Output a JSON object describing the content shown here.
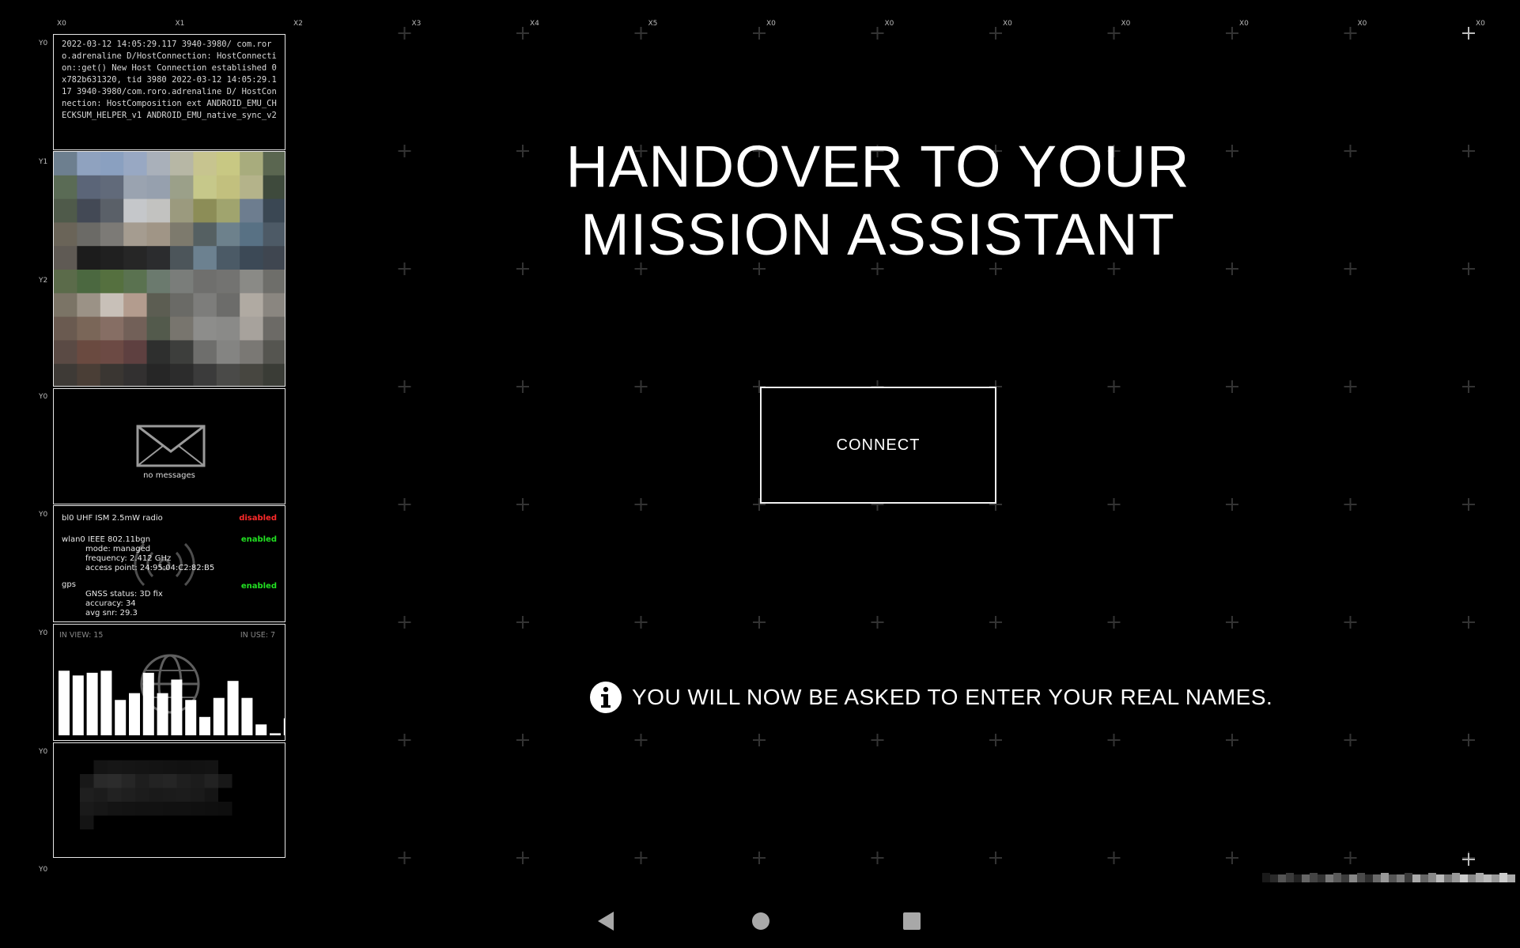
{
  "axis_labels": {
    "top": [
      "X0",
      "X1",
      "X2",
      "X3",
      "X4",
      "X5",
      "X0",
      "X0",
      "X0",
      "X0",
      "X0",
      "X0",
      "X0"
    ],
    "left": [
      "Y0",
      "Y1",
      "Y2",
      "Y0",
      "Y0",
      "Y0",
      "Y0",
      "Y0"
    ]
  },
  "log": {
    "text": "2022-03-12 14:05:29.117 3940-3980/ com.roro.adrenaline D/HostConnection: HostConnection::get() New Host Connection established 0x782b631320, tid 3980 2022-03-12 14:05:29.117 3940-3980/com.roro.adrenaline D/ HostConnection: HostComposition ext ANDROID_EMU_CHECKSUM_HELPER_v1 ANDROID_EMU_native_sync_v2"
  },
  "messages": {
    "empty_label": "no messages",
    "icon": "envelope-icon"
  },
  "status": {
    "radio": {
      "label": "bl0 UHF ISM 2.5mW radio",
      "state": "disabled"
    },
    "wlan": {
      "label": "wlan0 IEEE 802.11bgn",
      "state": "enabled",
      "mode": "mode: managed",
      "frequency": "frequency: 2.412 GHz",
      "access_point": "access point: 24:95:04:C2:82:B5"
    },
    "gps": {
      "label": "gps",
      "state": "enabled",
      "gnss": "GNSS status: 3D fix",
      "accuracy": "accuracy: 34",
      "snr": "avg snr: 29.3"
    },
    "colors": {
      "disabled": "#ff2a2a",
      "enabled": "#22e022"
    },
    "icon": "wifi-signal-icon"
  },
  "satellites": {
    "in_view_label": "IN VIEW: 15",
    "in_use_label": "IN USE: 7",
    "icon": "globe-icon",
    "bar_levels": [
      0.95,
      0.88,
      0.92,
      0.95,
      0.52,
      0.62,
      0.92,
      0.62,
      0.82,
      0.52,
      0.27,
      0.55,
      0.8,
      0.55,
      0.16,
      0.03,
      0.25
    ]
  },
  "main": {
    "title_line1": "HANDOVER TO YOUR",
    "title_line2": "MISSION ASSISTANT",
    "connect_label": "CONNECT",
    "info_text": "YOU WILL NOW BE ASKED TO ENTER YOUR REAL NAMES.",
    "info_icon": "info-icon"
  },
  "nav": {
    "back_icon": "back-triangle-icon",
    "home_icon": "home-circle-icon",
    "recents_icon": "recents-square-icon"
  }
}
